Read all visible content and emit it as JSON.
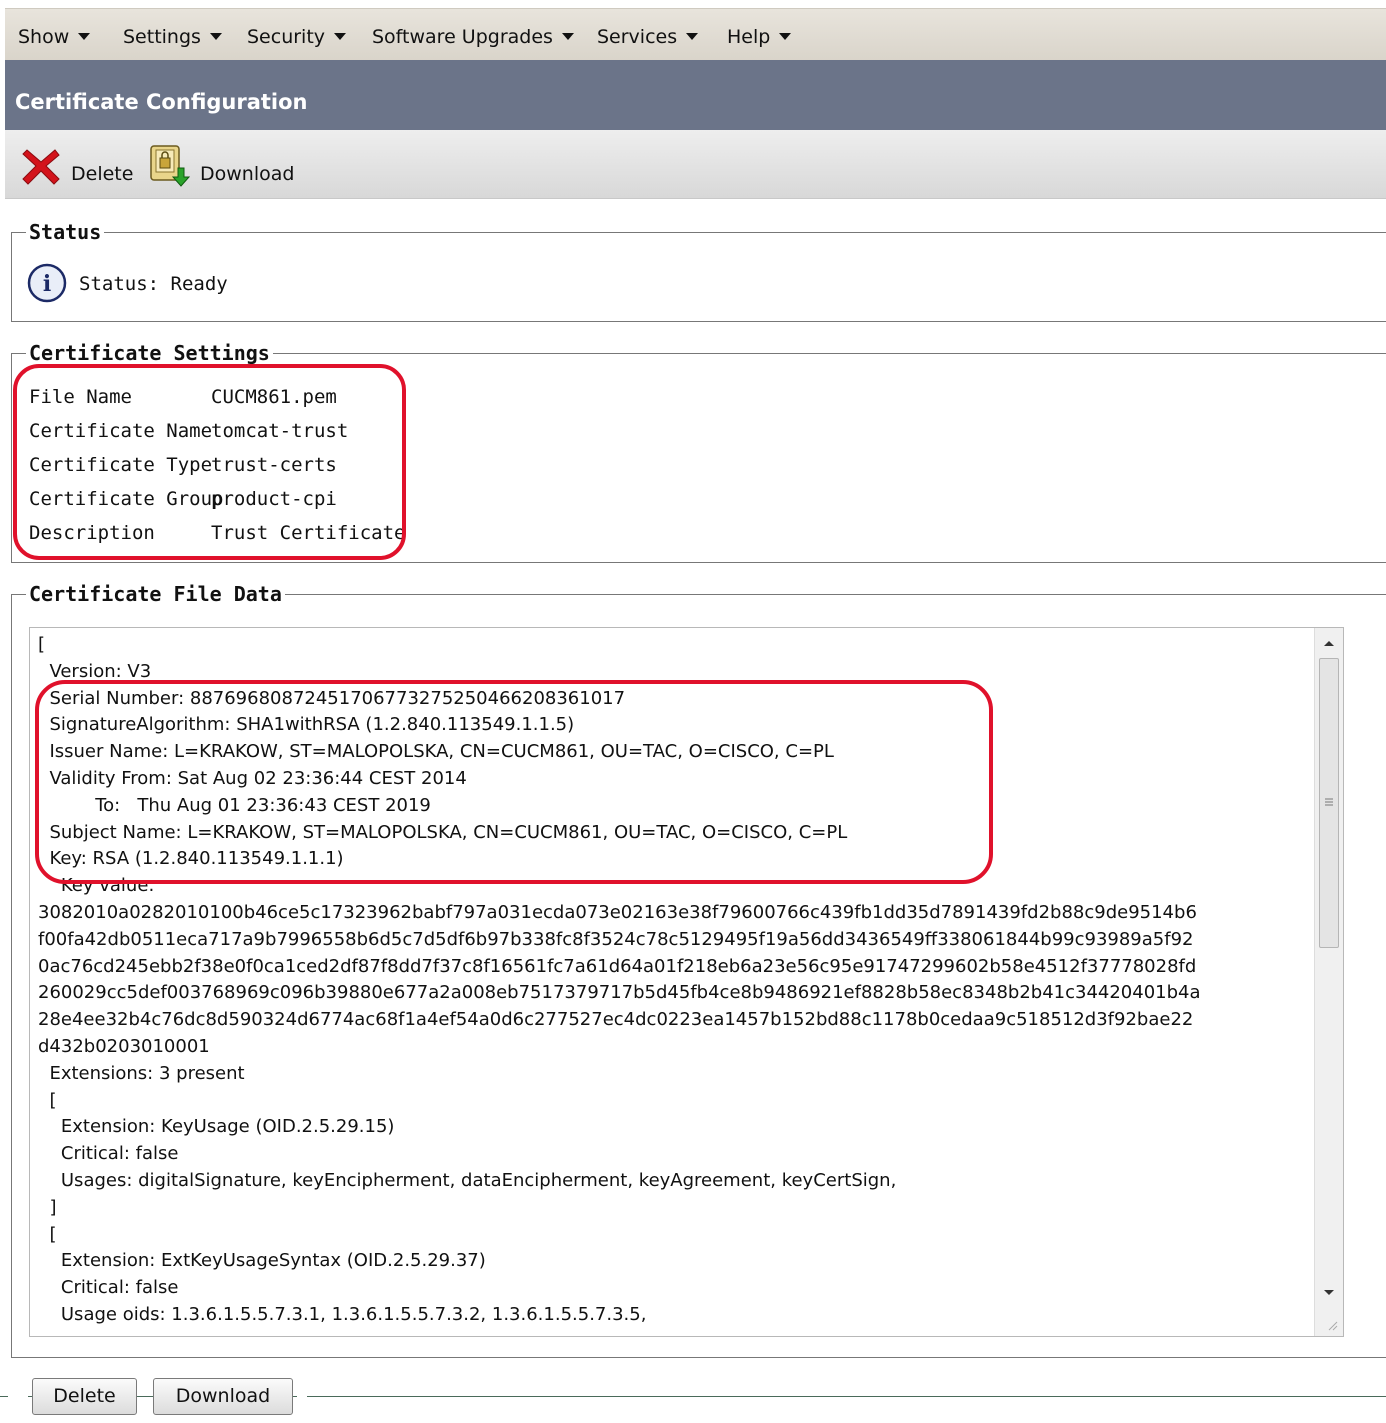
{
  "menu": {
    "items": [
      {
        "label": "Show"
      },
      {
        "label": "Settings"
      },
      {
        "label": "Security"
      },
      {
        "label": "Software Upgrades"
      },
      {
        "label": "Services"
      },
      {
        "label": "Help"
      }
    ]
  },
  "page": {
    "title": "Certificate Configuration"
  },
  "toolbar": {
    "delete_label": "Delete",
    "download_label": "Download"
  },
  "status": {
    "legend": "Status",
    "text": "Status: Ready",
    "icon": "info-icon"
  },
  "settings": {
    "legend": "Certificate Settings",
    "rows": [
      {
        "label": "File Name",
        "value": "CUCM861.pem"
      },
      {
        "label": "Certificate Name",
        "value": "tomcat-trust"
      },
      {
        "label": "Certificate Type",
        "value": "trust-certs"
      },
      {
        "label": "Certificate Group",
        "value": "product-cpi"
      },
      {
        "label": "Description",
        "value": "Trust Certificate"
      }
    ]
  },
  "file_data": {
    "legend": "Certificate File Data",
    "lines": [
      "[",
      "  Version: V3",
      "  Serial Number: 88769680872451706773275250466208361017",
      "  SignatureAlgorithm: SHA1withRSA (1.2.840.113549.1.1.5)",
      "  Issuer Name: L=KRAKOW, ST=MALOPOLSKA, CN=CUCM861, OU=TAC, O=CISCO, C=PL",
      "  Validity From: Sat Aug 02 23:36:44 CEST 2014",
      "          To:   Thu Aug 01 23:36:43 CEST 2019",
      "  Subject Name: L=KRAKOW, ST=MALOPOLSKA, CN=CUCM861, OU=TAC, O=CISCO, C=PL",
      "  Key: RSA (1.2.840.113549.1.1.1)",
      "    Key value:",
      "3082010a0282010100b46ce5c17323962babf797a031ecda073e02163e38f79600766c439fb1dd35d7891439fd2b88c9de9514b6",
      "f00fa42db0511eca717a9b7996558b6d5c7d5df6b97b338fc8f3524c78c5129495f19a56dd3436549ff338061844b99c93989a5f92",
      "0ac76cd245ebb2f38e0f0ca1ced2df87f8dd7f37c8f16561fc7a61d64a01f218eb6a23e56c95e91747299602b58e4512f37778028fd",
      "260029cc5def003768969c096b39880e677a2a008eb7517379717b5d45fb4ce8b9486921ef8828b58ec8348b2b41c34420401b4a",
      "28e4ee32b4c76dc8d590324d6774ac68f1a4ef54a0d6c277527ec4dc0223ea1457b152bd88c1178b0cedaa9c518512d3f92bae22",
      "d432b0203010001",
      "  Extensions: 3 present",
      "  [",
      "    Extension: KeyUsage (OID.2.5.29.15)",
      "    Critical: false",
      "    Usages: digitalSignature, keyEncipherment, dataEncipherment, keyAgreement, keyCertSign,",
      "  ]",
      "  [",
      "    Extension: ExtKeyUsageSyntax (OID.2.5.29.37)",
      "    Critical: false",
      "    Usage oids: 1.3.6.1.5.5.7.3.1, 1.3.6.1.5.5.7.3.2, 1.3.6.1.5.5.7.3.5,"
    ]
  },
  "buttons": {
    "delete": "Delete",
    "download": "Download"
  },
  "colors": {
    "title_bar": "#6b7489",
    "highlight": "#e0112b"
  }
}
